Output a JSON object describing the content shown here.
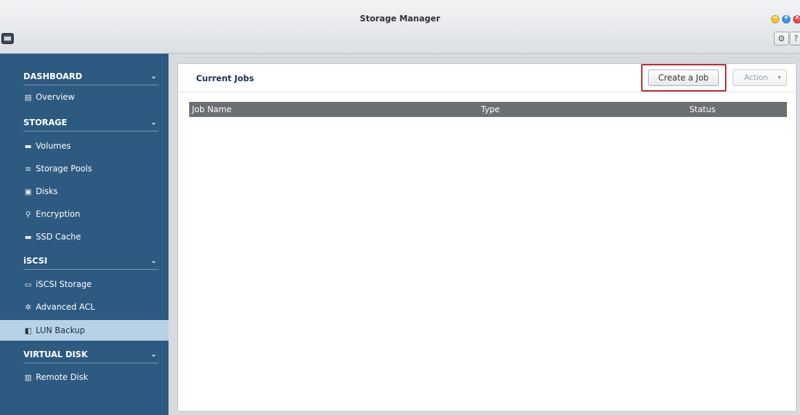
{
  "window": {
    "title": "Storage Manager",
    "minimize_glyph": "−",
    "maximize_glyph": "+",
    "close_glyph": "×"
  },
  "toolbar": {
    "settings_glyph": "⚙",
    "help_label": "?"
  },
  "sidebar": {
    "sections": [
      {
        "label": "DASHBOARD",
        "items": [
          {
            "label": "Overview",
            "icon": "overview-icon",
            "glyph": "▤"
          }
        ]
      },
      {
        "label": "STORAGE",
        "items": [
          {
            "label": "Volumes",
            "icon": "volume-icon",
            "glyph": "▬"
          },
          {
            "label": "Storage Pools",
            "icon": "storage-pool-icon",
            "glyph": "≡"
          },
          {
            "label": "Disks",
            "icon": "disk-icon",
            "glyph": "▣"
          },
          {
            "label": "Encryption",
            "icon": "key-icon",
            "glyph": "⚲"
          },
          {
            "label": "SSD Cache",
            "icon": "ssd-cache-icon",
            "glyph": "▬"
          }
        ]
      },
      {
        "label": "iSCSI",
        "items": [
          {
            "label": "iSCSI Storage",
            "icon": "iscsi-storage-icon",
            "glyph": "▭"
          },
          {
            "label": "Advanced ACL",
            "icon": "gear-icon",
            "glyph": "✲"
          },
          {
            "label": "LUN Backup",
            "icon": "lun-backup-icon",
            "glyph": "◧",
            "active": true
          }
        ]
      },
      {
        "label": "VIRTUAL DISK",
        "items": [
          {
            "label": "Remote Disk",
            "icon": "remote-disk-icon",
            "glyph": "▥"
          }
        ]
      }
    ],
    "chevron_glyph": "⌄"
  },
  "main": {
    "title": "Current Jobs",
    "create_button": "Create a Job",
    "action_button": "Action",
    "action_caret": "▾",
    "table": {
      "columns": [
        "Job Name",
        "Type",
        "Status"
      ],
      "rows": []
    }
  },
  "colors": {
    "sidebar_bg": "#2d5a80",
    "active_item_bg": "#b7d2e6",
    "highlight_border": "#c3242b",
    "table_header_bg": "#6b6e72"
  }
}
